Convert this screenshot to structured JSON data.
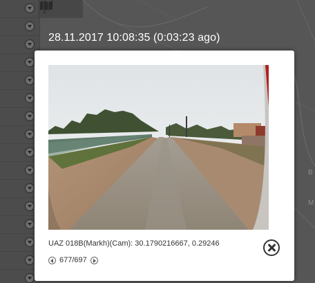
{
  "popup": {
    "timestamp": "28.11.2017 10:08:35 (0:03:23 ago)",
    "caption": "UAZ 018B(Markh)(Cam): 30.1790216667, 0.29246",
    "pager": {
      "position": "677/697",
      "prev_icon": "arrow-left-circle-icon",
      "next_icon": "arrow-right-circle-icon"
    },
    "close_icon": "close-circle-icon"
  },
  "map": {
    "toolbar_icon": "map-icon",
    "edge_labels": [
      "B",
      "M"
    ]
  },
  "colors": {
    "overlay": "#565656",
    "popup_bg": "#ffffff",
    "text": "#333333"
  }
}
